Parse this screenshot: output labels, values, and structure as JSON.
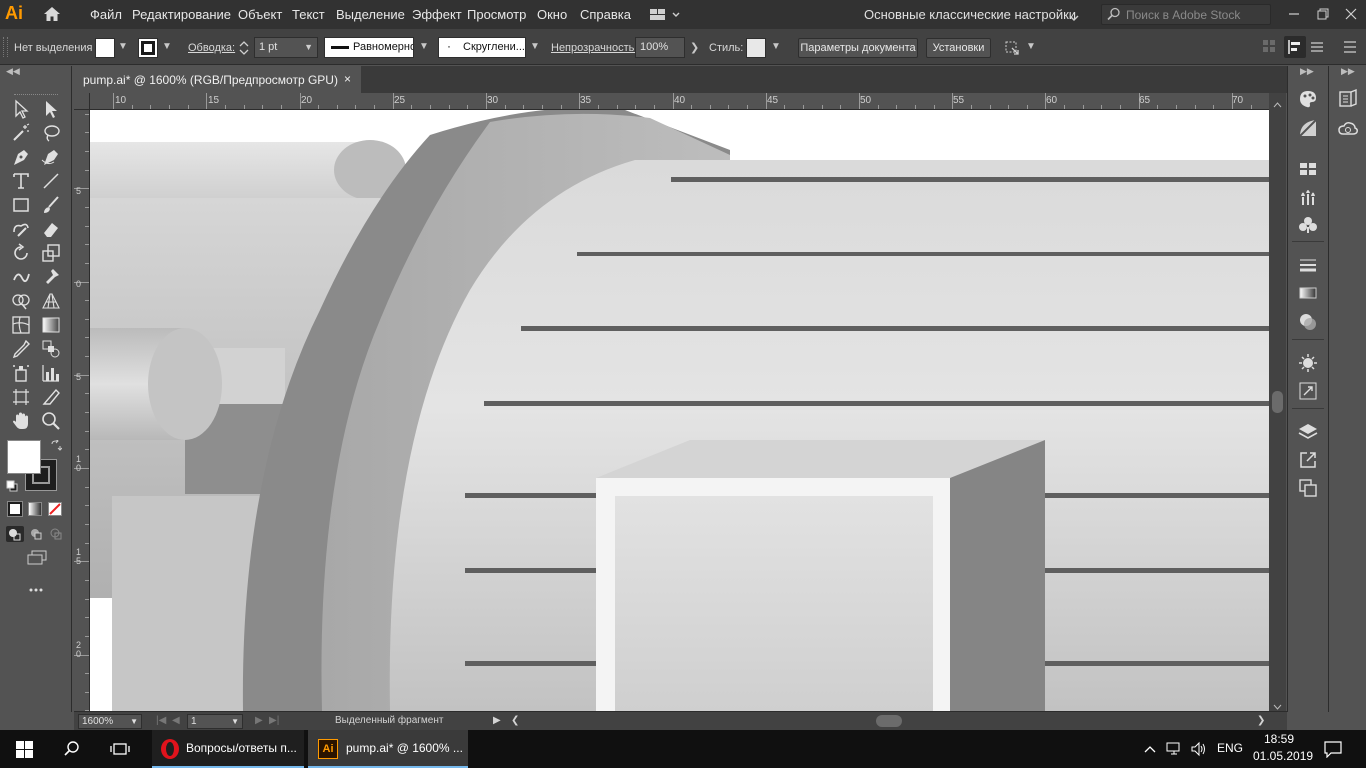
{
  "app": {
    "name": "Ai",
    "accent": "#ff9a00"
  },
  "menu": {
    "items": [
      "Файл",
      "Редактирование",
      "Объект",
      "Текст",
      "Выделение",
      "Эффект",
      "Просмотр",
      "Окно",
      "Справка"
    ],
    "workspace": "Основные классические настройки",
    "search_placeholder": "Поиск в Adobe Stock"
  },
  "control_bar": {
    "selection": "Нет выделения",
    "stroke_label": "Обводка:",
    "stroke_weight": "1 pt",
    "profile": "Равномерно",
    "brush": "Скруглени...",
    "opacity_label": "Непрозрачность:",
    "opacity_value": "100%",
    "style_label": "Стиль:",
    "doc_setup_button": "Параметры документа",
    "prefs_button": "Установки"
  },
  "document_tab": {
    "title": "pump.ai* @ 1600% (RGB/Предпросмотр GPU)",
    "close": "×"
  },
  "ruler_top": [
    "10",
    "15",
    "20",
    "25",
    "30",
    "35",
    "40",
    "45",
    "50",
    "55",
    "60",
    "65",
    "70"
  ],
  "ruler_left": [
    "5",
    "0",
    "5",
    "1 0",
    "1 5",
    "2 0"
  ],
  "status_bar": {
    "zoom": "1600%",
    "artboard": "1",
    "status_text": "Выделенный фрагмент"
  },
  "taskbar": {
    "apps": [
      {
        "label": "Вопросы/ответы п...",
        "icon": "opera-icon"
      },
      {
        "label": "pump.ai* @ 1600% ...",
        "icon": "illustrator-icon"
      }
    ],
    "language": "ENG",
    "time": "18:59",
    "date": "01.05.2019"
  }
}
